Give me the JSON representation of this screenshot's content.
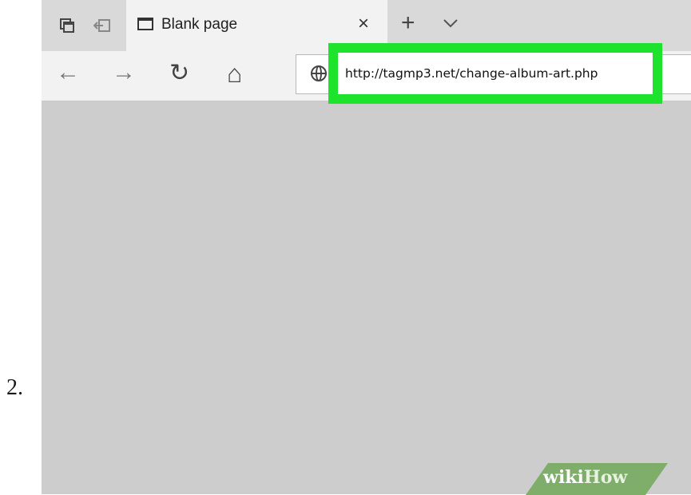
{
  "step": {
    "number": "2."
  },
  "browser": {
    "tab": {
      "title": "Blank page",
      "close_glyph": "×"
    },
    "new_tab_glyph": "+",
    "tab_menu_glyph": "⌵",
    "nav": {
      "back_glyph": "←",
      "forward_glyph": "→",
      "refresh_glyph": "↻",
      "home_glyph": "⌂"
    },
    "address": {
      "url": "http://tagmp3.net/change-album-art.php"
    },
    "icons": [
      "tabs-aside-icon",
      "set-aside-icon",
      "page-icon",
      "globe-icon"
    ]
  },
  "watermark": {
    "part1": "wiki",
    "part2": "How"
  },
  "colors": {
    "highlight": "#1ee32d",
    "page_bg": "#cdcdcd",
    "tabbar": "#d9d9d9"
  }
}
